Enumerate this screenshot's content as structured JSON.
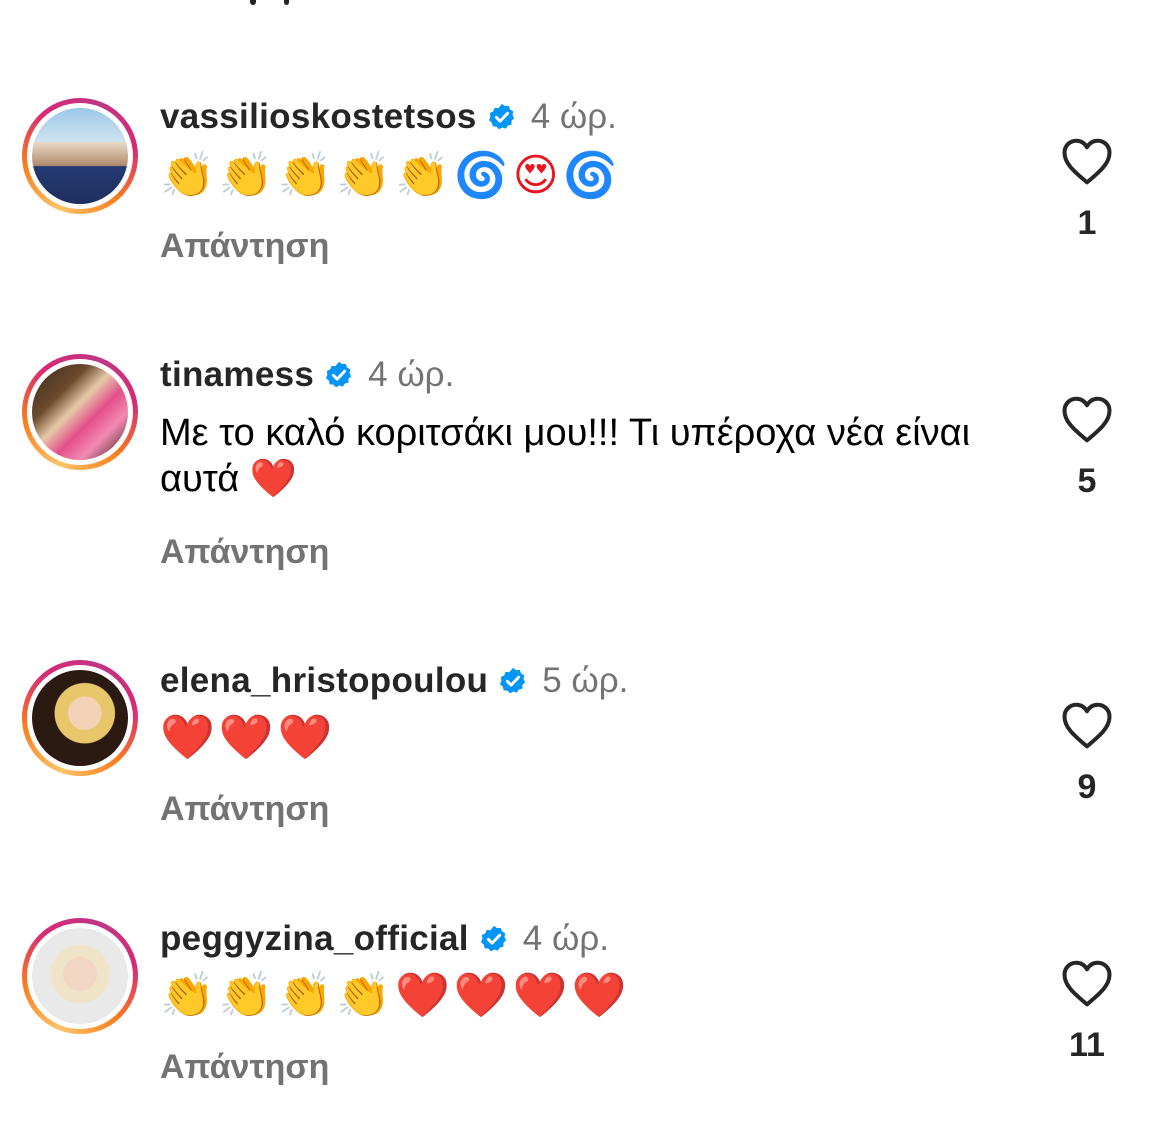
{
  "reply_label": "Απάντηση",
  "accent_colors": {
    "verified": "#0095f6",
    "meta_text": "#737373",
    "heart_emoji": "#e8141e"
  },
  "comments": [
    {
      "username": "vassilioskostetsos",
      "time": "4 ώρ.",
      "text": "👏👏👏👏👏🌀😍🌀",
      "likes": "1",
      "avatar_icon": "avatar-photo"
    },
    {
      "username": "tinamess",
      "time": "4 ώρ.",
      "text": "Με το καλό κοριτσάκι μου!!! Τι υπέροχα νέα είναι αυτά ❤️",
      "likes": "5",
      "avatar_icon": "avatar-photo"
    },
    {
      "username": "elena_hristopoulou",
      "time": "5 ώρ.",
      "text": "❤️❤️❤️",
      "likes": "9",
      "avatar_icon": "avatar-photo"
    },
    {
      "username": "peggyzina_official",
      "time": "4 ώρ.",
      "text": "👏👏👏👏❤️❤️❤️❤️",
      "likes": "11",
      "avatar_icon": "avatar-photo"
    }
  ]
}
